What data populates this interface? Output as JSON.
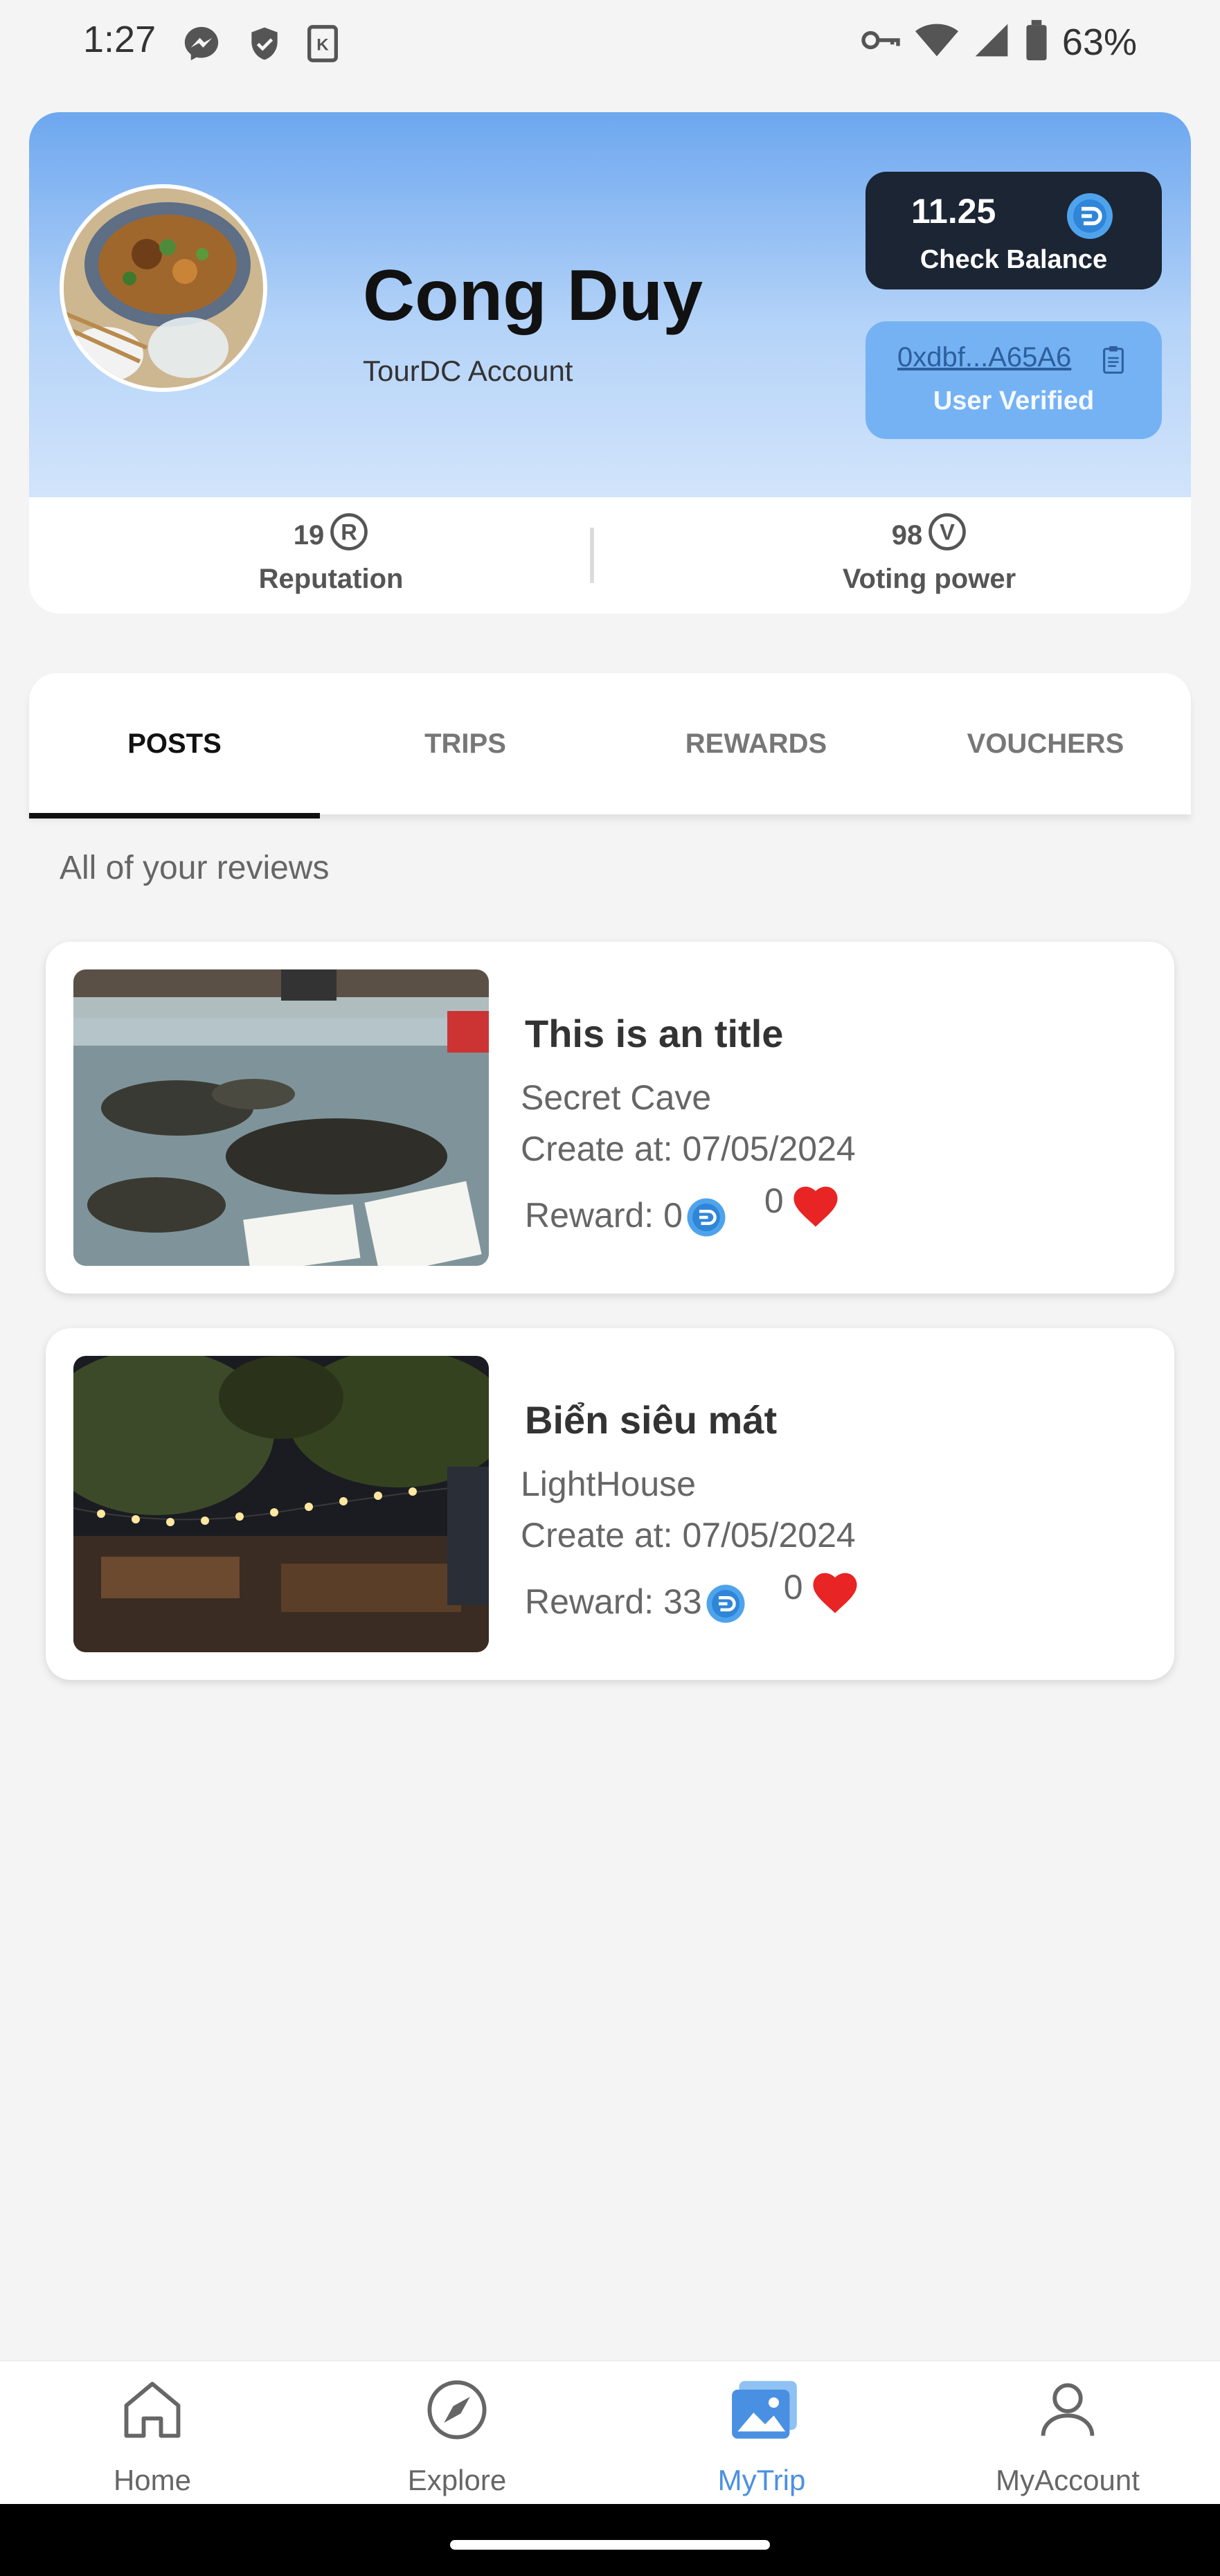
{
  "status_bar": {
    "time": "1:27",
    "left_icons": [
      "messenger-icon",
      "shield-icon",
      "app-k-icon"
    ],
    "right_icons": [
      "vpn-key-icon",
      "wifi-icon",
      "signal-icon",
      "battery-icon"
    ],
    "battery": "63%"
  },
  "profile": {
    "name": "Cong Duy",
    "account_type": "TourDC Account",
    "balance": "11.25",
    "balance_label": "Check Balance",
    "wallet_address": "0xdbf...A65A6",
    "verified_label": "User Verified",
    "reputation_value": "19",
    "reputation_icon_letter": "R",
    "reputation_label": "Reputation",
    "voting_value": "98",
    "voting_icon_letter": "V",
    "voting_label": "Voting power"
  },
  "tabs": [
    {
      "label": "POSTS",
      "active": true
    },
    {
      "label": "TRIPS",
      "active": false
    },
    {
      "label": "REWARDS",
      "active": false
    },
    {
      "label": "VOUCHERS",
      "active": false
    }
  ],
  "section_label": "All of your reviews",
  "posts": [
    {
      "title": "This is an title",
      "location": "Secret Cave",
      "created": "Create at: 07/05/2024",
      "reward_label": "Reward: 0",
      "likes": "0"
    },
    {
      "title": "Biển siêu mát",
      "location": "LightHouse",
      "created": "Create at: 07/05/2024",
      "reward_label": "Reward: 33",
      "likes": "0"
    }
  ],
  "bottom_nav": [
    {
      "label": "Home",
      "icon": "home-icon",
      "active": false
    },
    {
      "label": "Explore",
      "icon": "compass-icon",
      "active": false
    },
    {
      "label": "MyTrip",
      "icon": "gallery-icon",
      "active": true
    },
    {
      "label": "MyAccount",
      "icon": "user-icon",
      "active": false
    }
  ],
  "colors": {
    "accent": "#4a90e2",
    "balance_bg": "#1c2533",
    "verified_bg": "#74b2f4",
    "heart": "#e82424"
  }
}
